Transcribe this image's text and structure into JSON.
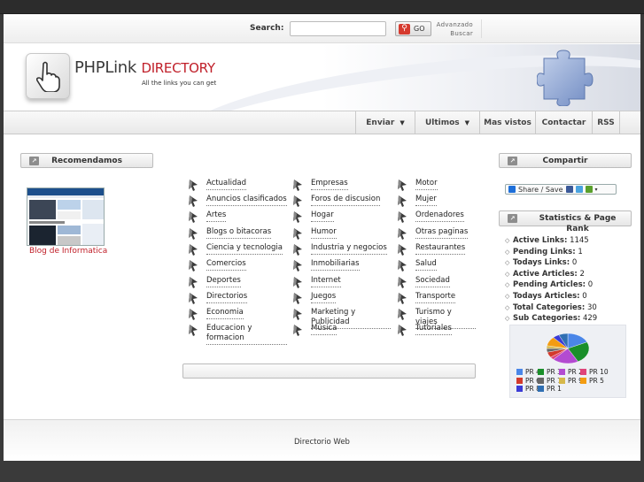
{
  "search": {
    "label": "Search:",
    "value": "",
    "placeholder": "",
    "go_label": "GO",
    "advanced_line1": "Advanzado",
    "advanced_line2": "Buscar"
  },
  "header": {
    "logo_part1": "PHPLink",
    "logo_part2": "DIRECTORY",
    "tagline": "All the links you can get"
  },
  "nav": {
    "items": [
      {
        "label": "Enviar",
        "dropdown": true
      },
      {
        "label": "Ultimos",
        "dropdown": true
      },
      {
        "label": "Mas vistos",
        "dropdown": false
      },
      {
        "label": "Contactar",
        "dropdown": false
      },
      {
        "label": "RSS",
        "dropdown": false
      }
    ]
  },
  "left": {
    "title": "Recomendamos",
    "blog_link": "Blog de Informatica"
  },
  "categories": {
    "col1": [
      "Actualidad",
      "Anuncios clasificados",
      "Artes",
      "Blogs o bitacoras",
      "Ciencia y tecnologia",
      "Comercios",
      "Deportes",
      "Directorios",
      "Economia",
      "Educacion y formacion"
    ],
    "col2": [
      "Empresas",
      "Foros de discusion",
      "Hogar",
      "Humor",
      "Industria y negocios",
      "Inmobiliarias",
      "Internet",
      "Juegos",
      "Marketing y Publicidad",
      "Música"
    ],
    "col3": [
      "Motor",
      "Mujer",
      "Ordenadores",
      "Otras paginas",
      "Restaurantes",
      "Salud",
      "Sociedad",
      "Transporte",
      "Turismo y viajes",
      "Tutoriales"
    ]
  },
  "share": {
    "title": "Compartir",
    "button": "Share / Save"
  },
  "stats": {
    "title": "Statistics & Page Rank",
    "items": [
      {
        "label": "Active Links:",
        "value": "1145"
      },
      {
        "label": "Pending Links:",
        "value": "1"
      },
      {
        "label": "Todays Links:",
        "value": "0"
      },
      {
        "label": "Active Articles:",
        "value": "2"
      },
      {
        "label": "Pending Articles:",
        "value": "0"
      },
      {
        "label": "Todays Articles:",
        "value": "0"
      },
      {
        "label": "Total Categories:",
        "value": "30"
      },
      {
        "label": "Sub Categories:",
        "value": "429"
      }
    ]
  },
  "chart_data": {
    "type": "pie",
    "title": "",
    "legend_position": "bottom",
    "series": [
      {
        "name": "PR 4",
        "value": 18,
        "color": "#4a86e8"
      },
      {
        "name": "PR 3",
        "value": 24,
        "color": "#1a8f2a"
      },
      {
        "name": "PR 2",
        "value": 20,
        "color": "#b34bd1"
      },
      {
        "name": "PR 10",
        "value": 3,
        "color": "#e0447a"
      },
      {
        "name": "PR 6",
        "value": 6,
        "color": "#d33a2c"
      },
      {
        "name": "PR 7",
        "value": 4,
        "color": "#666666"
      },
      {
        "name": "PR 9",
        "value": 3,
        "color": "#d6b84a"
      },
      {
        "name": "PR 5",
        "value": 10,
        "color": "#f39c12"
      },
      {
        "name": "PR 8",
        "value": 5,
        "color": "#3b3bd6"
      },
      {
        "name": "PR 1",
        "value": 7,
        "color": "#2f6fb3"
      }
    ]
  },
  "footer": {
    "text": "Directorio Web"
  }
}
